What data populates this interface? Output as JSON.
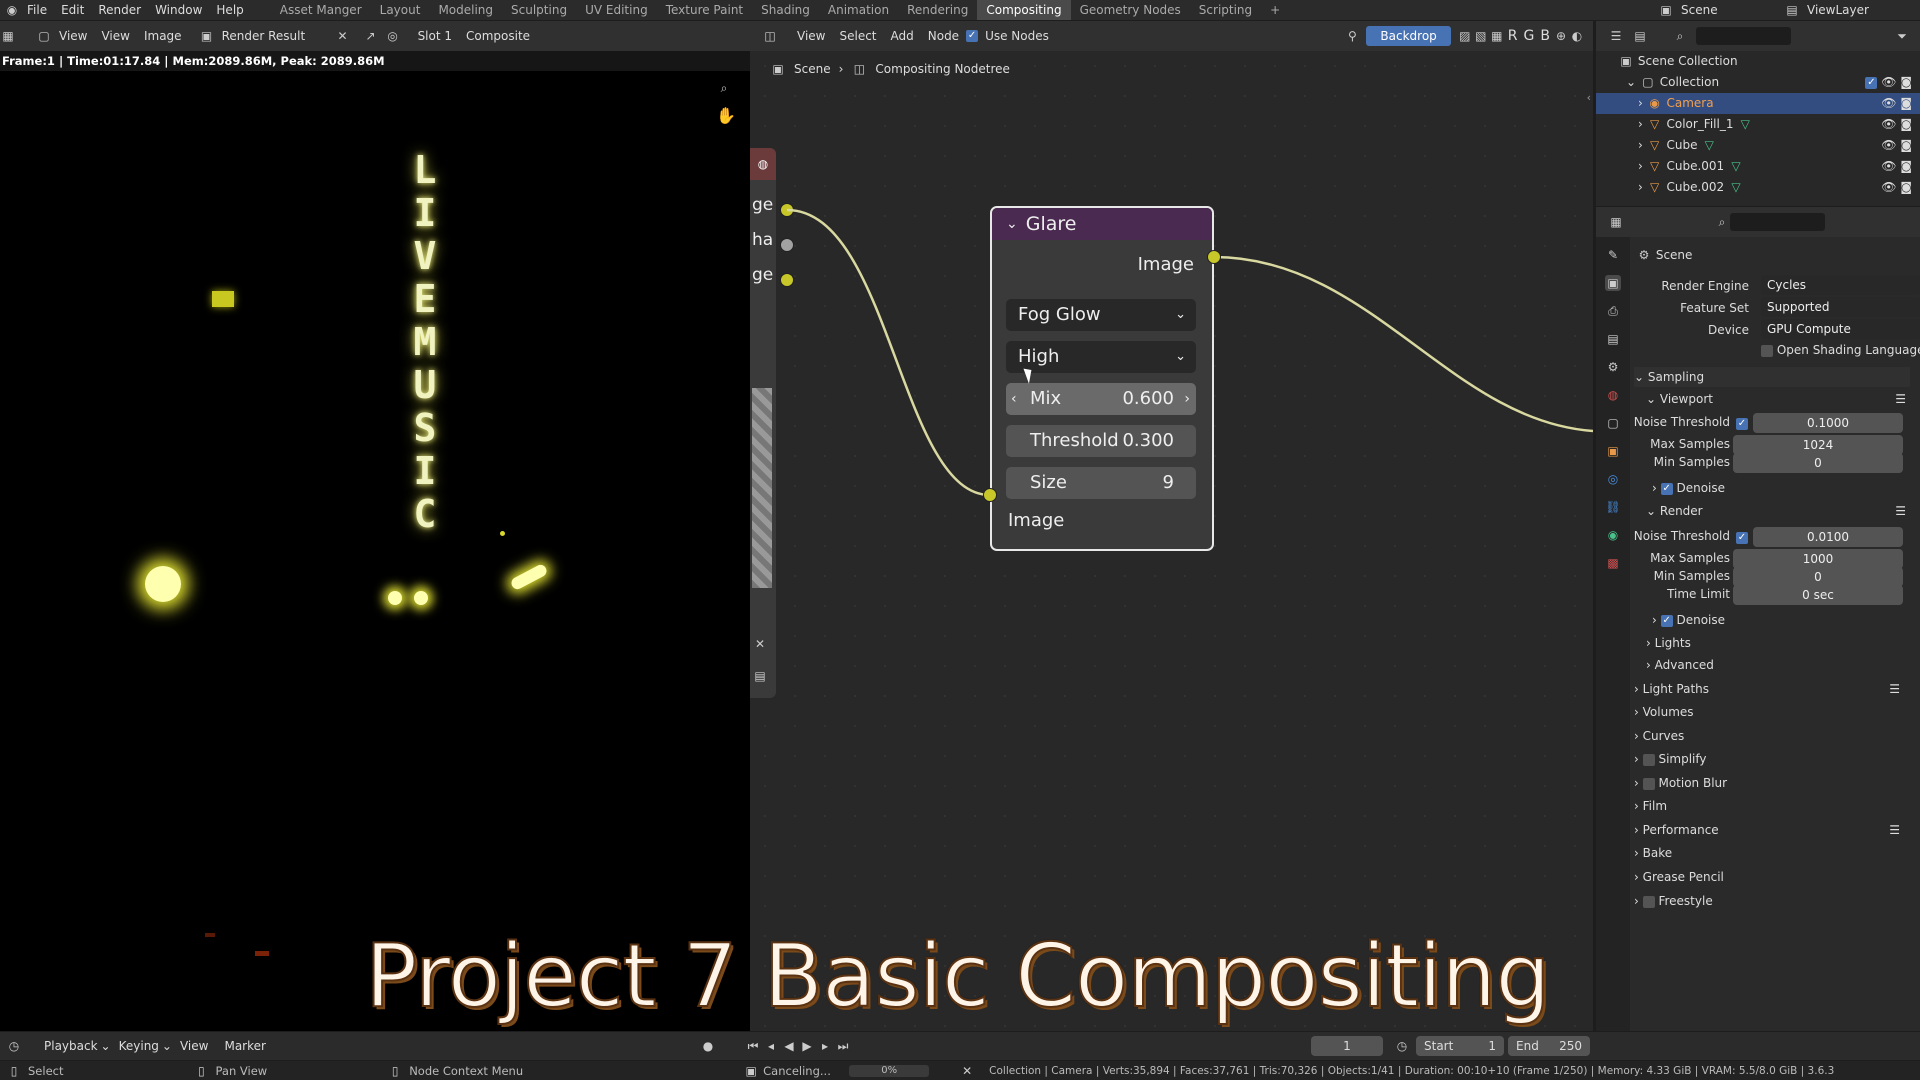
{
  "topbar": {
    "menus": [
      "File",
      "Edit",
      "Render",
      "Window",
      "Help"
    ],
    "workspaces": [
      "Asset Manger",
      "Layout",
      "Modeling",
      "Sculpting",
      "UV Editing",
      "Texture Paint",
      "Shading",
      "Animation",
      "Rendering",
      "Compositing",
      "Geometry Nodes",
      "Scripting"
    ],
    "active_workspace": "Compositing",
    "scene_label": "Scene",
    "viewlayer_label": "ViewLayer"
  },
  "image_editor": {
    "header_items": [
      "View",
      "View",
      "Image"
    ],
    "image_name": "Render Result",
    "slot": "Slot 1",
    "pass": "Composite",
    "frame_info": "Frame:1 | Time:01:17.84 | Mem:2089.86M, Peak: 2089.86M",
    "sign_text": [
      "L",
      "I",
      "V",
      "E",
      "M",
      "U",
      "S",
      "I",
      "C"
    ]
  },
  "node_editor": {
    "header_items": [
      "View",
      "Select",
      "Add",
      "Node"
    ],
    "use_nodes_label": "Use Nodes",
    "backdrop_label": "Backdrop",
    "channels": [
      "R",
      "G",
      "B"
    ],
    "breadcrumb": [
      "Scene",
      "Compositing Nodetree"
    ],
    "left_node_sockets": [
      "ge",
      "ha",
      "ge"
    ],
    "glare_node": {
      "title": "Glare",
      "output_label": "Image",
      "glare_type": "Fog Glow",
      "quality": "High",
      "mix_label": "Mix",
      "mix_value": "0.600",
      "threshold_label": "Threshold",
      "threshold_value": "0.300",
      "size_label": "Size",
      "size_value": "9",
      "input_label": "Image"
    }
  },
  "outliner": {
    "root": "Scene Collection",
    "collection": "Collection",
    "items": [
      "Camera",
      "Color_Fill_1",
      "Cube",
      "Cube.001",
      "Cube.002"
    ]
  },
  "properties": {
    "context": "Scene",
    "render_engine_label": "Render Engine",
    "render_engine": "Cycles",
    "feature_set_label": "Feature Set",
    "feature_set": "Supported",
    "device_label": "Device",
    "device": "GPU Compute",
    "osl_label": "Open Shading Language",
    "sampling": "Sampling",
    "viewport": "Viewport",
    "noise_threshold_label": "Noise Threshold",
    "vp_noise_threshold": "0.1000",
    "max_samples_label": "Max Samples",
    "vp_max_samples": "1024",
    "min_samples_label": "Min Samples",
    "vp_min_samples": "0",
    "denoise_label": "Denoise",
    "render": "Render",
    "r_noise_threshold": "0.0100",
    "r_max_samples": "1000",
    "r_min_samples": "0",
    "time_limit_label": "Time Limit",
    "time_limit": "0 sec",
    "sections": [
      "Lights",
      "Advanced",
      "Light Paths",
      "Volumes",
      "Curves",
      "Simplify",
      "Motion Blur",
      "Film",
      "Performance",
      "Bake",
      "Grease Pencil",
      "Freestyle"
    ]
  },
  "timeline": {
    "menus": [
      "Playback",
      "Keying",
      "View",
      "Marker"
    ],
    "current_frame": "1",
    "start_label": "Start",
    "start": "1",
    "end_label": "End",
    "end": "250"
  },
  "statusbar": {
    "select": "Select",
    "pan": "Pan View",
    "context_menu": "Node Context Menu",
    "job": "Canceling...",
    "progress": "0%",
    "stats": "Collection | Camera | Verts:35,894 | Faces:37,761 | Tris:70,326 | Objects:1/41 | Duration: 00:10+10 (Frame 1/250) | Memory: 4.33 GiB | VRAM: 5.5/8.0 GiB | 3.6.3"
  },
  "overlay_title": "Project 7 Basic Compositing"
}
